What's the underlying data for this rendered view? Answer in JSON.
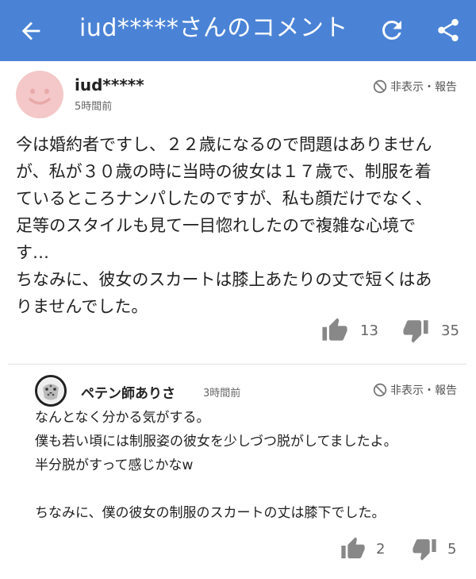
{
  "header": {
    "title": "iud*****さんのコメント"
  },
  "comment": {
    "user": "iud*****",
    "time": "5時間前",
    "hide_label": "非表示・報告",
    "lines": [
      "今は婚約者ですし、２２歳になるので問題はありません",
      "が、私が３０歳の時に当時の彼女は１７歳で、制服を着",
      "ているところナンパしたのですが、私も顔だけでなく、",
      "足等のスタイルも見て一目惚れしたので複雑な心境で",
      "す…",
      "ちなみに、彼女のスカートは膝上あたりの丈で短くはあ",
      "りませんでした。"
    ],
    "likes": "13",
    "dislikes": "35"
  },
  "reply": {
    "user": "ペテン師ありさ",
    "time": "3時間前",
    "hide_label": "非表示・報告",
    "lines": [
      "なんとなく分かる気がする。",
      "僕も若い頃には制服姿の彼女を少しづつ脱がしてましたよ。",
      "半分脱がすって感じかなw",
      "",
      "ちなみに、僕の彼女の制服のスカートの丈は膝下でした。"
    ],
    "likes": "2",
    "dislikes": "5"
  },
  "colors": {
    "appbar": "#4a83d6",
    "avatar": "#f4c8c8",
    "icon_gray": "#888888"
  }
}
